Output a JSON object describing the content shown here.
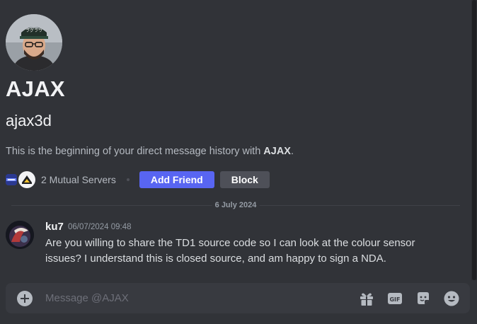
{
  "profile": {
    "display_name": "AJAX",
    "username": "ajax3d",
    "intro_prefix": "This is the beginning of your direct message history with ",
    "intro_name": "AJAX",
    "intro_suffix": ".",
    "mutual_servers_label": "2 Mutual Servers",
    "avatar_cap_text": "ラグラウ"
  },
  "actions": {
    "add_friend_label": "Add Friend",
    "block_label": "Block"
  },
  "divider": {
    "date": "6 July 2024"
  },
  "message": {
    "author": "ku7",
    "timestamp": "06/07/2024 09:48",
    "text": "Are you willing to share the TD1 source code so I can look at the colour sensor issues?  I understand this is closed source, and am happy to sign a NDA."
  },
  "composer": {
    "placeholder": "Message @AJAX",
    "icons": [
      "add-attachment-icon",
      "gift-icon",
      "gif-icon",
      "sticker-icon",
      "emoji-icon"
    ]
  },
  "colors": {
    "background": "#313338",
    "accent": "#5865f2",
    "block_button": "#4e5058",
    "composer": "#383a40"
  }
}
